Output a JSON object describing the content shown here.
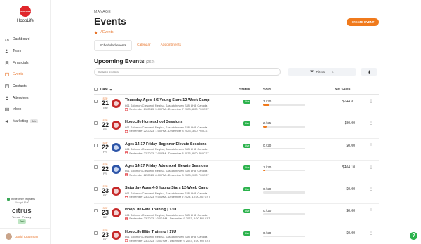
{
  "brand": {
    "logo_text": "HOOPLIFE",
    "name": "HoopLife"
  },
  "nav": [
    {
      "label": "Dashboard",
      "icon": "gauge-icon",
      "active": false
    },
    {
      "label": "Team",
      "icon": "users-icon",
      "active": false
    },
    {
      "label": "Financials",
      "icon": "document-icon",
      "active": false
    },
    {
      "label": "Events",
      "icon": "calendar-icon",
      "active": true
    },
    {
      "label": "Contacts",
      "icon": "contacts-icon",
      "active": false
    },
    {
      "label": "Attendees",
      "icon": "person-icon",
      "active": false
    },
    {
      "label": "Inbox",
      "icon": "inbox-icon",
      "active": false
    },
    {
      "label": "Marketing",
      "icon": "megaphone-icon",
      "active": false,
      "badge": "Beta"
    }
  ],
  "sidebar_footer": {
    "invite_title": "Invite other programs",
    "invite_sub": "You get $100",
    "logo": "citrus",
    "legal": "Terms · Privacy",
    "test_badge": "Test",
    "user_name": "David Crossman"
  },
  "header": {
    "eyebrow": "MANAGE",
    "title": "Events",
    "breadcrumb": "Events",
    "create_button": "CREATE EVENT"
  },
  "tabs": [
    {
      "label": "Scheduled events",
      "active": true
    },
    {
      "label": "Calendar",
      "active": false
    },
    {
      "label": "Appointments",
      "active": false
    }
  ],
  "section": {
    "title": "Upcoming Events",
    "count": "(262)"
  },
  "toolbar": {
    "search_placeholder": "Search events",
    "filters_label": "Filters",
    "filters_count": "1"
  },
  "table": {
    "columns": {
      "date": "Date",
      "status": "Status",
      "sold": "Sold",
      "net": "Net Sales"
    },
    "rows": [
      {
        "month": "SEP",
        "day": "21",
        "weekday": "THU",
        "name": "Thursday Ages 4-6 Young Stars 12-Week Camp",
        "address": "661 Solomon Crescent, Regina, Saskatchewan S4N 8H8, Canada",
        "time": "September 21 2023, 5:00 PM - December 7 2023, 8:00 PM CST",
        "status": "Live",
        "sold": "3 / 20",
        "sold_fraction": 0.15,
        "net": "$644.81",
        "thumb": "red"
      },
      {
        "month": "SEP",
        "day": "22",
        "weekday": "FRI",
        "name": "HoopLife Homeschool Sessions",
        "address": "661 Solomon Crescent, Regina, Saskatchewan S4N 8H8, Canada",
        "time": "September 22 2023, 1:00 PM - December 8 2023, 3:00 PM CST",
        "status": "Live",
        "sold": "2 / 25",
        "sold_fraction": 0.08,
        "net": "$90.00",
        "thumb": "red"
      },
      {
        "month": "SEP",
        "day": "22",
        "weekday": "FRI",
        "name": "Ages 14-17 Friday Beginner Elevate Sessions",
        "address": "661 Solomon Crescent, Regina, Saskatchewan S4N 8H8, Canada",
        "time": "September 22 2023, 7:00 PM - December 8 2023, 8:00 PM CST",
        "status": "Live",
        "sold": "0 / 20",
        "sold_fraction": 0,
        "net": "$0.00",
        "thumb": "blue"
      },
      {
        "month": "SEP",
        "day": "22",
        "weekday": "FRI",
        "name": "Ages 14-17 Friday Advanced Elevate Sessions",
        "address": "661 Solomon Crescent, Regina, Saskatchewan S4N 8H8, Canada",
        "time": "September 22 2023, 8:00 PM - December 8 2023, 9:00 PM CST",
        "status": "Live",
        "sold": "1 / 20",
        "sold_fraction": 0.05,
        "net": "$404.10",
        "thumb": "blue"
      },
      {
        "month": "SEP",
        "day": "23",
        "weekday": "SAT",
        "name": "Saturday Ages 4-6 Young Stars 12-Week Camp",
        "address": "661 Solomon Crescent, Regina, Saskatchewan S4N 8H8, Canada",
        "time": "September 23 2023, 9:00 AM - December 9 2023, 10:00 AM CST",
        "status": "Live",
        "sold": "0 / 20",
        "sold_fraction": 0,
        "net": "$0.00",
        "thumb": "red"
      },
      {
        "month": "SEP",
        "day": "23",
        "weekday": "SAT",
        "name": "HoopLife Elite Training | 13U",
        "address": "661 Solomon Crescent, Regina, Saskatchewan S4N 8H8, Canada",
        "time": "September 23 2023, 10:00 AM - December 9 2023, 8:00 PM CST",
        "status": "Live",
        "sold": "0 / 20",
        "sold_fraction": 0,
        "net": "$0.00",
        "thumb": "red"
      },
      {
        "month": "SEP",
        "day": "23",
        "weekday": "SAT",
        "name": "HoopLife Elite Training | 17U",
        "address": "661 Solomon Crescent, Regina, Saskatchewan S4N 8H8, Canada",
        "time": "September 23 2023, 10:00 AM - December 9 2023, 8:00 PM CST",
        "status": "Live",
        "sold": "0 / 20",
        "sold_fraction": 0,
        "net": "$0.00",
        "thumb": "red"
      }
    ]
  },
  "colors": {
    "accent": "#f07a1c",
    "brand_red": "#e0262b",
    "live_green": "#2bb24c"
  },
  "help": "?"
}
